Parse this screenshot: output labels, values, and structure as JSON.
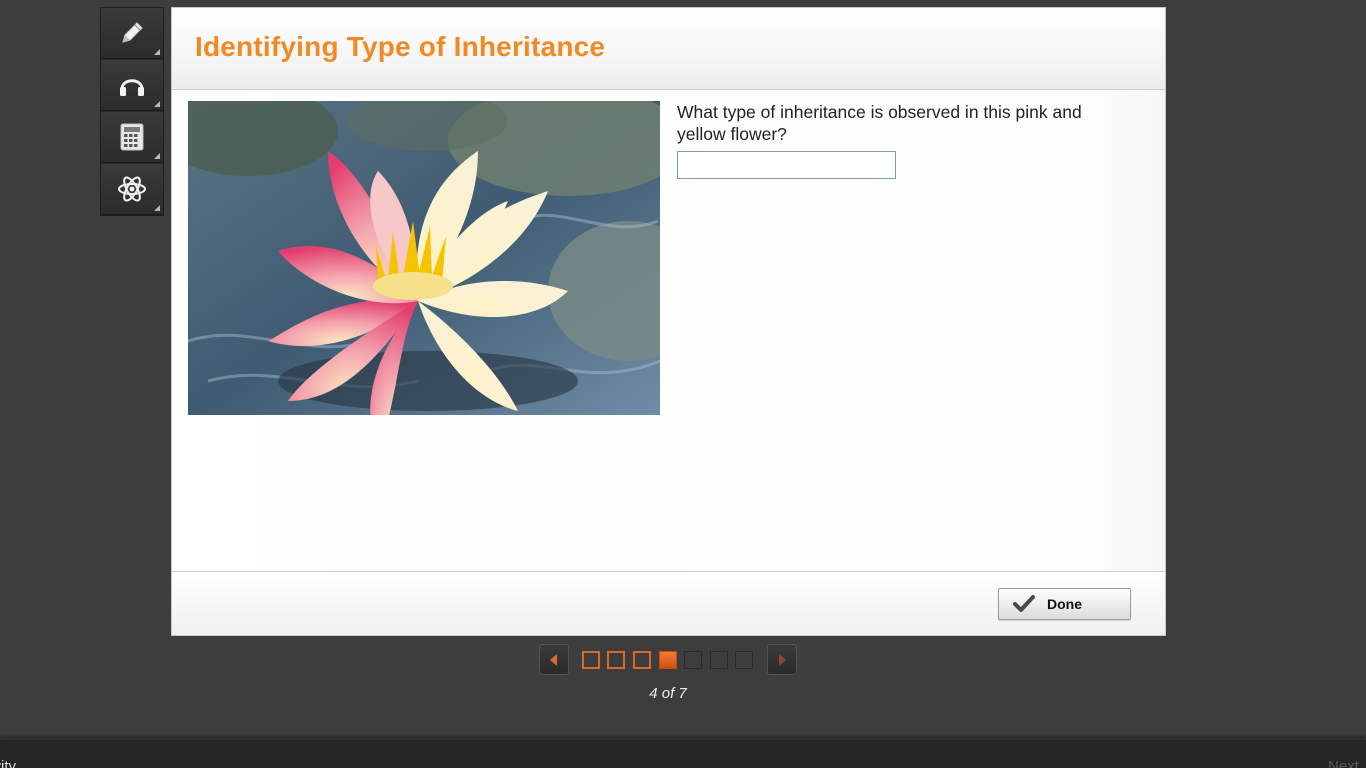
{
  "toolbar": {
    "tools": [
      {
        "name": "pencil-icon"
      },
      {
        "name": "headphones-icon"
      },
      {
        "name": "calculator-icon"
      },
      {
        "name": "atom-icon"
      }
    ]
  },
  "activity": {
    "title": "Identifying Type of Inheritance",
    "question": "What type of inheritance is observed in this pink and yellow flower?",
    "answer_value": "",
    "done_label": "Done"
  },
  "pager": {
    "current": 4,
    "total": 7,
    "counter_text": "4 of 7"
  },
  "bottom_bar": {
    "left_text": "tivity",
    "right_text": "Next"
  },
  "colors": {
    "title": "#f08a24",
    "page_visited": "#d86a28",
    "page_current": "#e0601c",
    "background": "#3d3d3d"
  }
}
